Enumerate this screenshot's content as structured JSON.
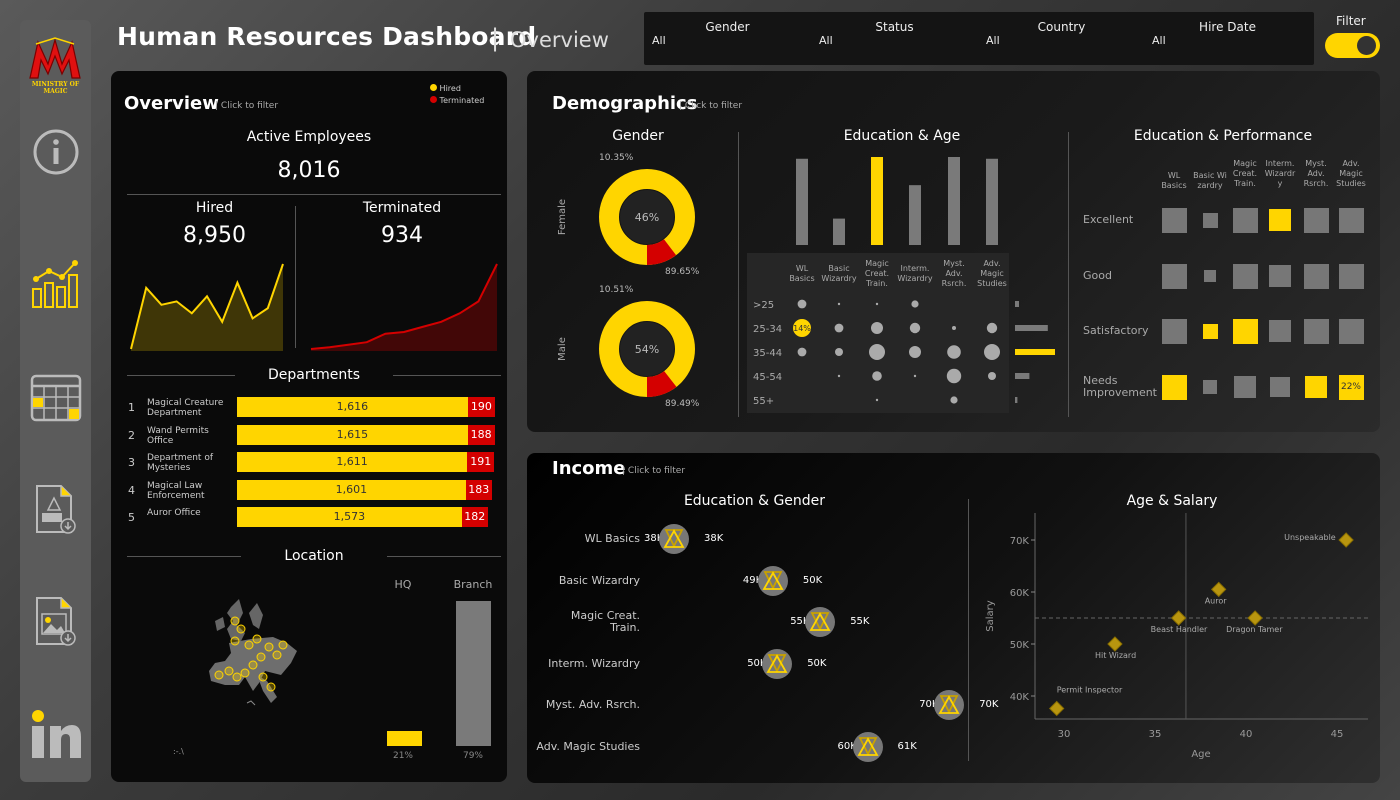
{
  "header": {
    "title": "Human Resources Dashboard",
    "separator": "|",
    "subtitle": "Overview"
  },
  "logo": {
    "text": "MINISTRY OF MAGIC"
  },
  "filters": [
    {
      "label": "Gender",
      "value": "All"
    },
    {
      "label": "Status",
      "value": "All"
    },
    {
      "label": "Country",
      "value": "All"
    },
    {
      "label": "Hire Date",
      "value": "All"
    }
  ],
  "filter_toggle": {
    "label": "Filter",
    "on": true
  },
  "colors": {
    "accent": "#ffd500",
    "terminated": "#d40000",
    "neutral": "#777777"
  },
  "sidebar": [
    {
      "name": "info-icon"
    },
    {
      "name": "chart-icon"
    },
    {
      "name": "calendar-icon"
    },
    {
      "name": "pdf-export-icon"
    },
    {
      "name": "image-export-icon"
    },
    {
      "name": "linkedin-icon"
    }
  ],
  "overview": {
    "title": "Overview",
    "hint": "Click to filter",
    "legend": [
      "Hired",
      "Terminated"
    ],
    "active_label": "Active Employees",
    "active_value": "8,016",
    "hired_label": "Hired",
    "hired_value": "8,950",
    "terminated_label": "Terminated",
    "terminated_value": "934",
    "hired_trend": [
      0.0,
      0.72,
      0.52,
      0.56,
      0.42,
      0.62,
      0.32,
      0.78,
      0.36,
      0.48,
      1.0
    ],
    "terminated_trend": [
      0.0,
      0.02,
      0.05,
      0.08,
      0.18,
      0.2,
      0.26,
      0.32,
      0.42,
      0.56,
      1.0
    ],
    "departments_title": "Departments",
    "departments": [
      {
        "idx": "1",
        "name": "Magical Creature Department",
        "hired": "1,616",
        "terminated": "190",
        "h": 1616,
        "t": 190
      },
      {
        "idx": "2",
        "name": "Wand Permits Office",
        "hired": "1,615",
        "terminated": "188",
        "h": 1615,
        "t": 188
      },
      {
        "idx": "3",
        "name": "Department of Mysteries",
        "hired": "1,611",
        "terminated": "191",
        "h": 1611,
        "t": 191
      },
      {
        "idx": "4",
        "name": "Magical Law Enforcement",
        "hired": "1,601",
        "terminated": "183",
        "h": 1601,
        "t": 183
      },
      {
        "idx": "5",
        "name": "Auror Office",
        "hired": "1,573",
        "terminated": "182",
        "h": 1573,
        "t": 182
      }
    ],
    "location_title": "Location",
    "hq_label": "HQ",
    "branch_label": "Branch",
    "hq_pct": "21%",
    "branch_pct": "79%",
    "hq_share": 0.21,
    "branch_share": 0.79
  },
  "demographics": {
    "title": "Demographics",
    "hint": "Click to filter",
    "gender_title": "Gender",
    "gender": [
      {
        "label": "Female",
        "center": "46%",
        "terminated_pct": "10.35%",
        "hired_pct": "89.65%",
        "t": 0.1035
      },
      {
        "label": "Male",
        "center": "54%",
        "terminated_pct": "10.51%",
        "hired_pct": "89.49%",
        "t": 0.1051
      }
    ],
    "edu_age_title": "Education & Age",
    "edu_cols": [
      "WL Basics",
      "Basic Wizardry",
      "Magic Creat. Train.",
      "Interm. Wizardry",
      "Myst. Adv. Rsrch.",
      "Adv. Magic Studies"
    ],
    "edu_col_lines": [
      [
        "WL",
        "Basics"
      ],
      [
        "Basic",
        "Wizardry"
      ],
      [
        "Magic",
        "Creat.",
        "Train."
      ],
      [
        "Interm.",
        "Wizardry"
      ],
      [
        "Myst.",
        "Adv.",
        "Rsrch."
      ],
      [
        "Adv.",
        "Magic",
        "Studies"
      ]
    ],
    "edu_totals": [
      0.98,
      0.3,
      1.0,
      0.68,
      1.0,
      0.98
    ],
    "edu_highlight": 2,
    "age_rows": [
      ">25",
      "25-34",
      "35-44",
      "45-54",
      "55+"
    ],
    "age_totals": [
      0.1,
      0.82,
      1.0,
      0.36,
      0.06
    ],
    "age_highlight": 2,
    "bubble_highlight_label": "14%",
    "bubbles": [
      [
        0.55,
        0.12,
        0.15,
        0.45,
        0.0,
        0.0
      ],
      [
        1.0,
        0.55,
        0.75,
        0.65,
        0.25,
        0.65
      ],
      [
        0.55,
        0.5,
        1.0,
        0.75,
        0.85,
        1.0
      ],
      [
        0.0,
        0.12,
        0.6,
        0.15,
        0.9,
        0.5
      ],
      [
        0.0,
        0.0,
        0.12,
        0.0,
        0.45,
        0.0
      ]
    ],
    "edu_perf_title": "Education & Performance",
    "perf_cols": [
      "WL Basics",
      "Basic Wizardry",
      "Magic Creat. Train.",
      "Intermediate Wizardry",
      "Myst. Adv. Rsrch.",
      "Adv. Magic Studies"
    ],
    "perf_col_lines": [
      [
        "WL",
        "Basics"
      ],
      [
        "Basic Wi",
        "zardry"
      ],
      [
        "Magic",
        "Creat.",
        "Train."
      ],
      [
        "Interm.",
        "Wizardr",
        "y"
      ],
      [
        "Myst.",
        "Adv.",
        "Rsrch."
      ],
      [
        "Adv.",
        "Magic",
        "Studies"
      ]
    ],
    "perf_rows": [
      "Excellent",
      "Good",
      "Satisfactory",
      "Needs Improvement"
    ],
    "perf_row_lines": [
      [
        "Excellent"
      ],
      [
        "Good"
      ],
      [
        "Satisfactory"
      ],
      [
        "Needs",
        "Improvement"
      ]
    ],
    "perf_sizes": [
      [
        1.0,
        0.6,
        1.0,
        0.85,
        1.0,
        1.0
      ],
      [
        1.0,
        0.45,
        1.0,
        0.9,
        1.0,
        1.0
      ],
      [
        1.0,
        0.6,
        1.0,
        0.85,
        1.0,
        1.0
      ],
      [
        1.0,
        0.55,
        0.9,
        0.8,
        0.9,
        1.0
      ]
    ],
    "perf_yellow": [
      [
        0,
        3
      ],
      [
        2,
        1
      ],
      [
        2,
        2
      ],
      [
        3,
        0
      ],
      [
        3,
        4
      ],
      [
        3,
        5
      ]
    ],
    "perf_label": "22%"
  },
  "income": {
    "title": "Income",
    "hint": "Click to filter",
    "edu_gender_title": "Education & Gender",
    "edu_gender": [
      {
        "label": "WL Basics",
        "label_lines": [
          "WL Basics"
        ],
        "left": "38K",
        "right": "38K",
        "v": 38
      },
      {
        "label": "Basic Wizardry",
        "label_lines": [
          "Basic Wizardry"
        ],
        "left": "49K",
        "right": "50K",
        "v": 49.5
      },
      {
        "label": "Magic Creat. Train.",
        "label_lines": [
          "Magic Creat.",
          "Train."
        ],
        "left": "55K",
        "right": "55K",
        "v": 55
      },
      {
        "label": "Interm. Wizardry",
        "label_lines": [
          "Interm. Wizardry"
        ],
        "left": "50K",
        "right": "50K",
        "v": 50
      },
      {
        "label": "Myst. Adv. Rsrch.",
        "label_lines": [
          "Myst. Adv. Rsrch."
        ],
        "left": "70K",
        "right": "70K",
        "v": 70
      },
      {
        "label": "Adv. Magic Studies",
        "label_lines": [
          "Adv. Magic Studies"
        ],
        "left": "60K",
        "right": "61K",
        "v": 60.5
      }
    ],
    "age_salary_title": "Age & Salary",
    "xlabel": "Age",
    "ylabel": "Salary",
    "x_ticks": [
      "30",
      "35",
      "40",
      "45"
    ],
    "y_ticks": [
      "40K",
      "50K",
      "60K",
      "70K"
    ],
    "points": [
      {
        "label": "Unspeakable",
        "age": 45.5,
        "salary": 70,
        "lx": -62,
        "ly": -4
      },
      {
        "label": "Auror",
        "age": 38.5,
        "salary": 60.5,
        "lx": -14,
        "ly": 10
      },
      {
        "label": "Beast Handler",
        "age": 36.3,
        "salary": 55,
        "lx": -28,
        "ly": 10
      },
      {
        "label": "Dragon Tamer",
        "age": 40.5,
        "salary": 55,
        "lx": -29,
        "ly": 10
      },
      {
        "label": "Hit Wizard",
        "age": 32.8,
        "salary": 50,
        "lx": -20,
        "ly": 10
      },
      {
        "label": "Permit Inspector",
        "age": 29.6,
        "salary": 37.6,
        "lx": 0,
        "ly": -20
      }
    ]
  }
}
